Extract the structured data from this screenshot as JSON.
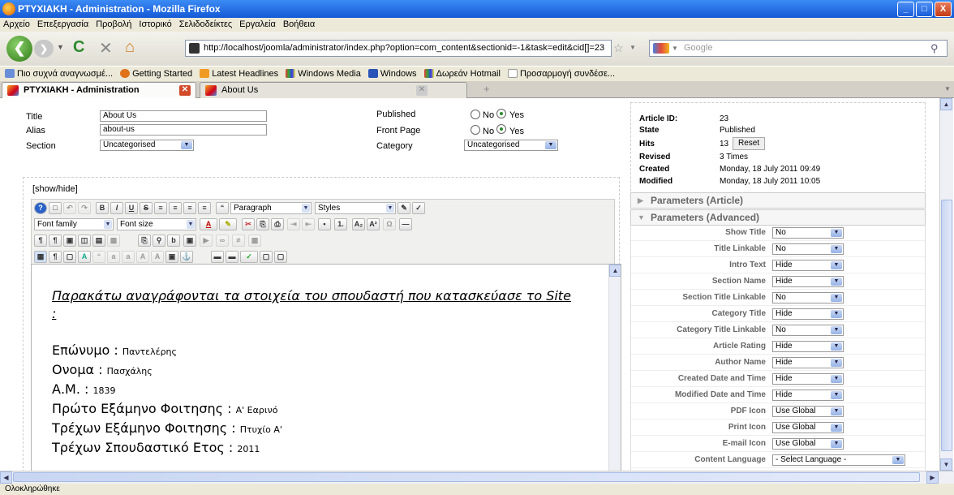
{
  "window": {
    "title": "PTYXIAKH - Administration - Mozilla Firefox",
    "min": "_",
    "max": "□",
    "close": "X"
  },
  "menu": [
    "Αρχείο",
    "Επεξεργασία",
    "Προβολή",
    "Ιστορικό",
    "Σελιδοδείκτες",
    "Εργαλεία",
    "Βοήθεια"
  ],
  "nav": {
    "url": "http://localhost/joomla/administrator/index.php?option=com_content&sectionid=-1&task=edit&cid[]=23",
    "search_placeholder": "Google"
  },
  "bookmarks": [
    "Πιο συχνά αναγνωσμέ...",
    "Getting Started",
    "Latest Headlines",
    "Windows Media",
    "Windows",
    "Δωρεάν Hotmail",
    "Προσαρμογή συνδέσε..."
  ],
  "tabs": [
    {
      "label": "PTYXIAKH - Administration"
    },
    {
      "label": "About Us"
    }
  ],
  "form": {
    "title_label": "Title",
    "title_value": "About Us",
    "alias_label": "Alias",
    "alias_value": "about-us",
    "section_label": "Section",
    "section_value": "Uncategorised",
    "published_label": "Published",
    "frontpage_label": "Front Page",
    "category_label": "Category",
    "category_value": "Uncategorised",
    "no": "No",
    "yes": "Yes",
    "published": "yes",
    "frontpage": "yes"
  },
  "editor": {
    "showhide": "[show/hide]",
    "format": "Paragraph",
    "styles": "Styles",
    "font_family": "Font family",
    "font_size": "Font size",
    "heading": "Παρακάτω αναγράφονται τα στοιχεία του σπουδαστή που κατασκεύασε το Site :",
    "lines": [
      {
        "k": "Επώνυμο :",
        "v": "Παντελέρης"
      },
      {
        "k": "Ονομα :",
        "v": "Πασχάλης"
      },
      {
        "k": "Α.Μ. :",
        "v": "1839"
      },
      {
        "k": "Πρώτο Εξάμηνο Φοιτησης :",
        "v": "Α' Εαρινό"
      },
      {
        "k": "Τρέχων Εξάμηνο Φοιτησης :",
        "v": "Πτυχίο Α'"
      },
      {
        "k": "Τρέχων Σπουδαστικό Ετος :",
        "v": "2011"
      }
    ]
  },
  "info": {
    "article_id_label": "Article ID:",
    "article_id": "23",
    "state_label": "State",
    "state": "Published",
    "hits_label": "Hits",
    "hits": "13",
    "reset": "Reset",
    "revised_label": "Revised",
    "revised": "3 Times",
    "created_label": "Created",
    "created": "Monday, 18 July 2011 09:49",
    "modified_label": "Modified",
    "modified": "Monday, 18 July 2011 10:05"
  },
  "params_article": "Parameters (Article)",
  "params_advanced": "Parameters (Advanced)",
  "params": [
    {
      "k": "Show Title",
      "v": "No"
    },
    {
      "k": "Title Linkable",
      "v": "No"
    },
    {
      "k": "Intro Text",
      "v": "Hide"
    },
    {
      "k": "Section Name",
      "v": "Hide"
    },
    {
      "k": "Section Title Linkable",
      "v": "No"
    },
    {
      "k": "Category Title",
      "v": "Hide"
    },
    {
      "k": "Category Title Linkable",
      "v": "No"
    },
    {
      "k": "Article Rating",
      "v": "Hide"
    },
    {
      "k": "Author Name",
      "v": "Hide"
    },
    {
      "k": "Created Date and Time",
      "v": "Hide"
    },
    {
      "k": "Modified Date and Time",
      "v": "Hide"
    },
    {
      "k": "PDF Icon",
      "v": "Use Global"
    },
    {
      "k": "Print Icon",
      "v": "Use Global"
    },
    {
      "k": "E-mail Icon",
      "v": "Use Global"
    },
    {
      "k": "Content Language",
      "v": "- Select Language -"
    }
  ],
  "status": "Ολοκληρώθηκε"
}
